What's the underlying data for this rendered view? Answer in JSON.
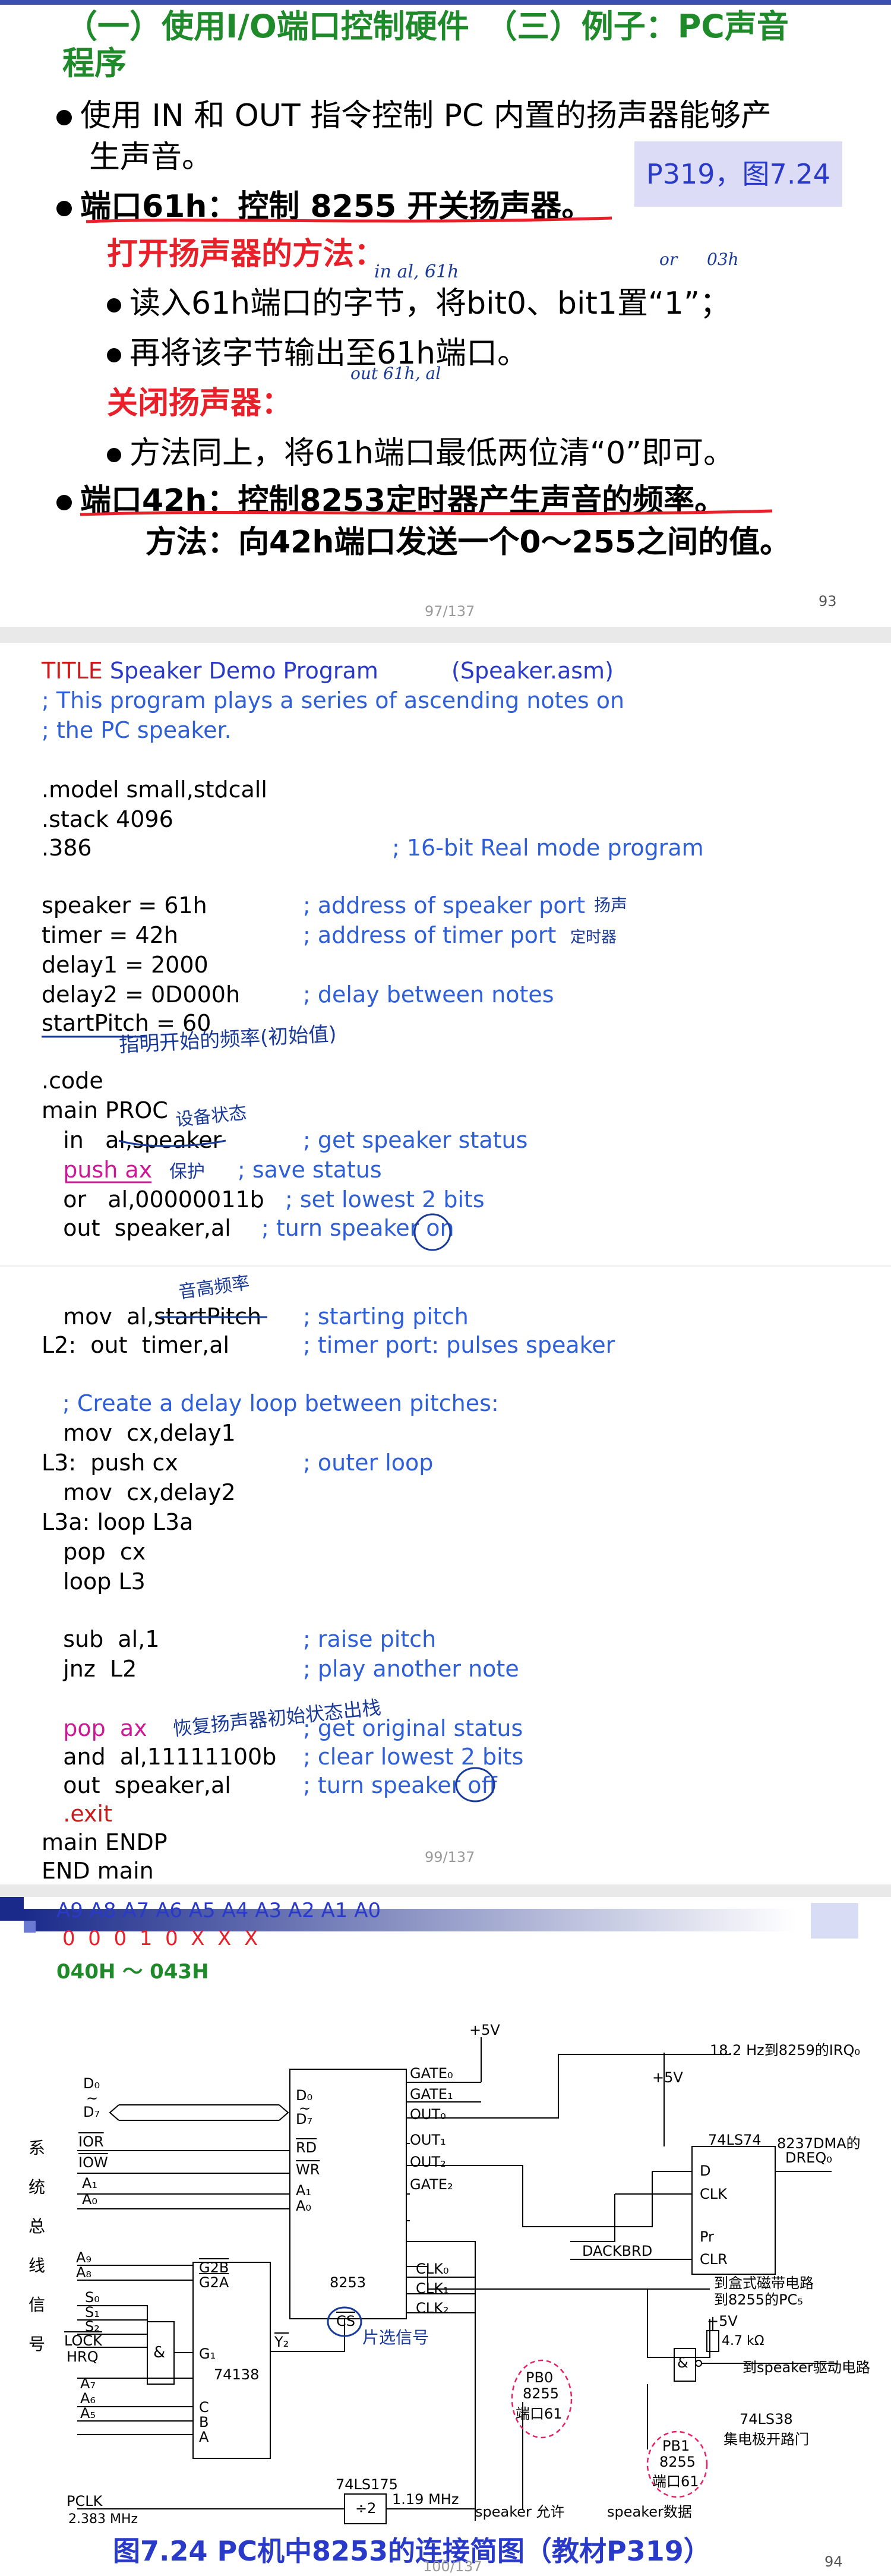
{
  "slide1": {
    "title_line1": "（一）使用I/O端口控制硬件　（三）例子：PC声音",
    "title_line2": "程序",
    "bullet1_line1": "使用 IN 和 OUT 指令控制 PC 内置的扬声器能够产",
    "bullet1_line2": "生声音。",
    "reference_box": "P319，图7.24",
    "bullet2": "端口61h：控制 8255 开关扬声器。",
    "open_heading": "打开扬声器的方法：",
    "open_step1": "读入61h端口的字节，将bit0、bit1置“1”；",
    "open_step2": "再将该字节输出至61h端口。",
    "close_heading": "关闭扬声器：",
    "close_step": "方法同上，将61h端口最低两位清“0”即可。",
    "bullet3": "端口42h：控制8253定时器产生声音的频率。",
    "method_line": "方法：向42h端口发送一个0～255之间的值。",
    "handwriting": {
      "in_al": "in al, 61h",
      "or": "or",
      "value": "03h",
      "out": "out 61h, al"
    },
    "page_indicator": "97/137",
    "slide_number": "93"
  },
  "slide2": {
    "lines": [
      {
        "code": "",
        "kw": "TITLE",
        "rest": " Speaker Demo Program",
        "tail": "(Speaker.asm)"
      },
      {
        "comment": "; This program plays a series of ascending notes on"
      },
      {
        "comment": "; the PC speaker."
      },
      {
        "code": ".model small,stdcall"
      },
      {
        "code": ".stack 4096"
      },
      {
        "code": ".386",
        "comment": "; 16-bit Real mode program"
      },
      {
        "code": "speaker    = 61h",
        "comment": "; address of speaker port"
      },
      {
        "code": "timer      = 42h",
        "comment": "; address of timer port"
      },
      {
        "code": "delay1     = 2000"
      },
      {
        "code": "delay2     = 0D000h",
        "comment": "; delay between notes"
      },
      {
        "code": "startPitch = 60"
      },
      {
        "code": ".code"
      },
      {
        "code": "main PROC"
      },
      {
        "code": "   in   al,speaker",
        "comment": "; get speaker status"
      },
      {
        "code": "   push ax",
        "comment": "; save status"
      },
      {
        "code": "   or   al,00000011b",
        "comment": "; set lowest 2 bits"
      },
      {
        "code": "   out  speaker,al",
        "comment": "; turn speaker on"
      },
      {
        "code": "   mov  al,startPitch",
        "comment": "; starting pitch"
      },
      {
        "code": "L2:  out  timer,al",
        "comment": "; timer port: pulses speaker"
      },
      {
        "comment": "; Create a delay loop between pitches:"
      },
      {
        "code": "   mov  cx,delay1"
      },
      {
        "code": "L3:  push cx",
        "comment": "; outer loop"
      },
      {
        "code": "   mov  cx,delay2"
      },
      {
        "code": "L3a: loop L3a"
      },
      {
        "code": "   pop  cx"
      },
      {
        "code": "   loop L3"
      },
      {
        "code": "   sub  al,1",
        "comment": "; raise pitch"
      },
      {
        "code": "   jnz  L2",
        "comment": "; play another note"
      },
      {
        "code": "   pop  ax",
        "comment": "; get original status"
      },
      {
        "code": "   and  al,11111100b",
        "comment": "; clear lowest 2 bits"
      },
      {
        "code": "   out  speaker,al",
        "comment": "; turn speaker off"
      },
      {
        "code": "   .exit"
      },
      {
        "code": "main ENDP"
      },
      {
        "code": "END main"
      }
    ],
    "title_kw": "TITLE",
    "title_rest": "Speaker Demo Program",
    "title_file": "(Speaker.asm)",
    "handwriting": {
      "speaker_note": "扬声",
      "timer_note": "定时器",
      "startpitch_note": "指明开始的频率(初始值)",
      "status_note": "设备状态",
      "push_note": "保护",
      "pitch_note": "音高频率",
      "pop_note": "恢复扬声器初始状态出栈"
    },
    "page_indicator": "99/137"
  },
  "slide3": {
    "addr_bits": "A9 A8 A7 A6 A5 A4 A3 A2 A1 A0",
    "addr_values": "0  0  0  1  0  X  X  X",
    "addr_range": "040H ～ 043H",
    "system_bus_label": [
      "系",
      "统",
      "总",
      "线",
      "信",
      "号"
    ],
    "left_signals": [
      "D₀",
      "~",
      "D₇",
      "IOR",
      "IOW",
      "A₁",
      "A₀",
      "A₉",
      "A₈",
      "S₀",
      "S₁",
      "S₂",
      "LOCK",
      "HRQ",
      "A₇",
      "A₆",
      "A₅",
      "PCLK"
    ],
    "pclk_freq": "2.383 MHz",
    "chip_8253": "8253",
    "chip_8253_pins_left": [
      "D₀",
      "~",
      "D₇",
      "RD",
      "WR",
      "A₁",
      "A₀"
    ],
    "chip_8253_pins_right": [
      "GATE₀",
      "GATE₁",
      "OUT₀",
      "OUT₁",
      "OUT₂",
      "GATE₂",
      "CLK₀",
      "CLK₁",
      "CLK₂"
    ],
    "cs_label": "CS",
    "cs_note": "片选信号",
    "chip_74138": "74138",
    "chip_74138_pins": [
      "G2B",
      "G2A",
      "G₁",
      "C",
      "B",
      "A",
      "Y₂"
    ],
    "plus5v": "+5V",
    "irq_label": "18.2 Hz到8259的IRQ₀",
    "chip_74ls74": "74LS74",
    "chip_74ls74_pins": [
      "D",
      "CLK",
      "Pr",
      "CLR"
    ],
    "dma_label": "8237DMA的",
    "dreq_label": "DREQ₀",
    "dackbrd": "DACKBRD",
    "cassette_label": "到盒式磁带电路",
    "cassette_label2": "到8255的PC₅",
    "resistor": "4.7 kΩ",
    "speaker_drive": "到speaker驱动电路",
    "pb0_label": [
      "PB0",
      "8255",
      "端口61"
    ],
    "pb1_label": [
      "PB1",
      "8255",
      "端口61"
    ],
    "chip_74ls38": "74LS38",
    "oc_gate": "集电极开路门",
    "chip_74ls175": "74LS175",
    "div2": "÷2",
    "freq_119": "1.19 MHz",
    "speaker_enable": "speaker 允许",
    "speaker_data": "speaker数据",
    "caption": "图7.24  PC机中8253的连接简图（教材P319）",
    "page_indicator": "100/137",
    "slide_number": "94"
  }
}
